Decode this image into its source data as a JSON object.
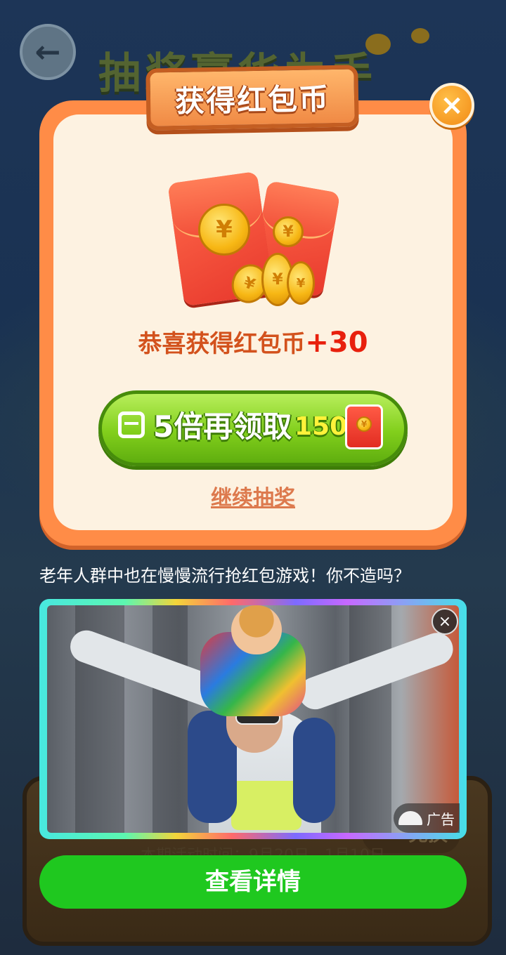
{
  "background": {
    "title_fragment": "抽奖赢华为手机",
    "board_pill": "兑换",
    "board_text": "本期活动时间：9月20日 - 1月10日"
  },
  "dialog": {
    "title": "获得红包币",
    "close_symbol": "×",
    "coin_symbol": "¥",
    "reward_prefix": "恭喜获得红包币",
    "reward_amount": "+30",
    "claim_label": "5倍再领取",
    "claim_amount": "150",
    "continue_label": "继续抽奖"
  },
  "ad": {
    "headline": "老年人群中也在慢慢流行抢红包游戏！你不造吗？",
    "close_symbol": "×",
    "tag_label": "广告",
    "cta_label": "查看详情"
  },
  "colors": {
    "dialog_border": "#ff8c47",
    "dialog_fill": "#fdf2e1",
    "claim_green": "#82cf1c",
    "reward_red": "#e8200d",
    "cta_green": "#1fc81f"
  }
}
